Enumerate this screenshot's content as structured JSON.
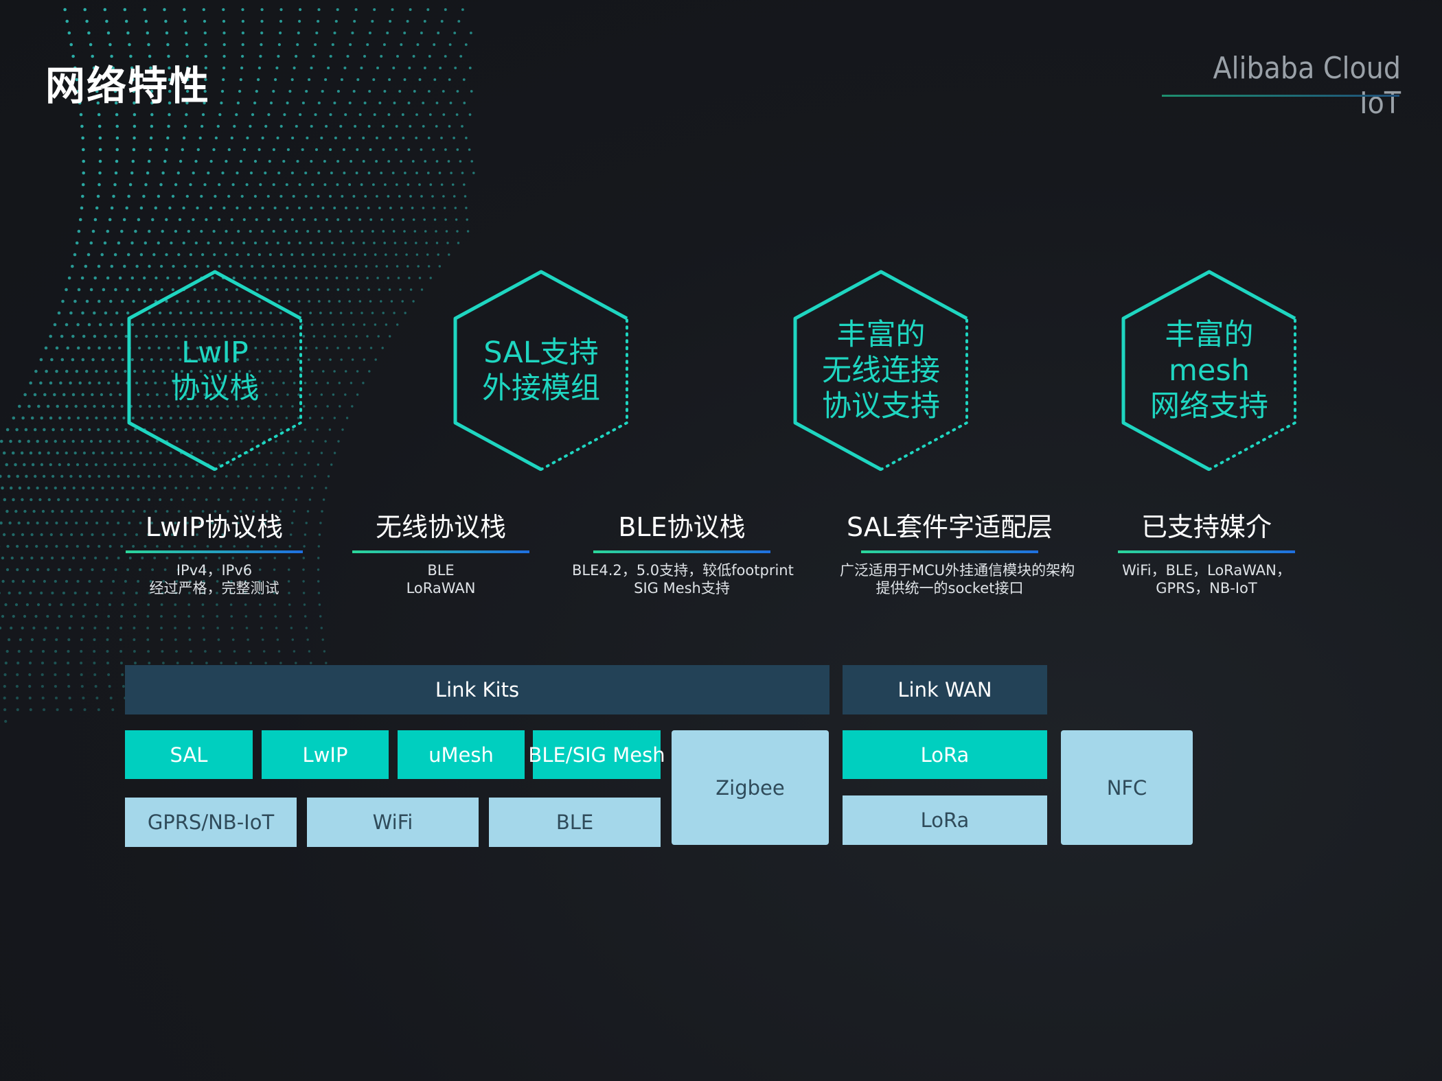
{
  "page": {
    "title": "网络特性",
    "brand": "Alibaba Cloud IoT"
  },
  "hexagons": [
    {
      "lines": [
        "LwIP",
        "协议栈"
      ]
    },
    {
      "lines": [
        "SAL支持",
        "外接模组"
      ]
    },
    {
      "lines": [
        "丰富的",
        "无线连接",
        "协议支持"
      ]
    },
    {
      "lines": [
        "丰富的",
        "mesh",
        "网络支持"
      ]
    }
  ],
  "features": [
    {
      "title": "LwIP协议栈",
      "desc": [
        "IPv4，IPv6",
        "经过严格，完整测试"
      ]
    },
    {
      "title": "无线协议栈",
      "desc": [
        "BLE",
        "LoRaWAN"
      ]
    },
    {
      "title": "BLE协议栈",
      "desc": [
        "BLE4.2，5.0支持，较低footprint",
        "SIG Mesh支持"
      ]
    },
    {
      "title": "SAL套件字适配层",
      "desc": [
        "广泛适用于MCU外挂通信模块的架构",
        "提供统一的socket接口"
      ]
    },
    {
      "title": "已支持媒介",
      "desc": [
        "WiFi，BLE，LoRaWAN，",
        "GPRS，NB-IoT"
      ]
    }
  ],
  "stack": {
    "link_kits": "Link Kits",
    "link_wan": "Link WAN",
    "row1": [
      "SAL",
      "LwIP",
      "uMesh",
      "BLE/SIG Mesh"
    ],
    "row2": [
      "GPRS/NB-IoT",
      "WiFi",
      "BLE"
    ],
    "zigbee": "Zigbee",
    "lora_top": "LoRa",
    "lora_bottom": "LoRa",
    "nfc": "NFC"
  },
  "colors": {
    "accent_teal": "#1fd6c1",
    "box_teal": "#00cfbf",
    "box_light": "#a4d7ea",
    "box_dark": "#234257"
  }
}
